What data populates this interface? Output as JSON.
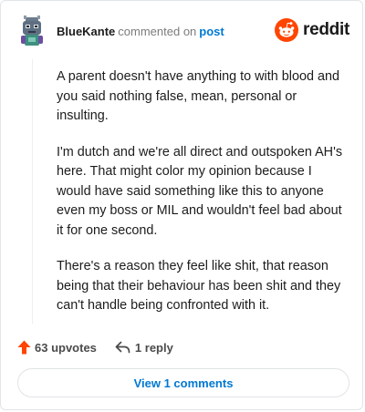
{
  "comment": {
    "author": "BlueKante",
    "action_text": "commented on",
    "post_link": "post",
    "paragraphs": [
      "A parent doesn't have anything to with blood and you said nothing false, mean, personal or insulting.",
      "I'm dutch and we're all direct and outspoken AH's here. That might color my opinion because I would have said something like this to anyone even my boss or MIL and wouldn't feel bad about it for one second.",
      "There's a reason they feel like shit, that reason being that their behaviour has been shit and they can't handle being confronted with it."
    ],
    "upvotes": "63 upvotes",
    "replies": "1 reply",
    "view_comments": "View 1 comments"
  },
  "brand": {
    "wordmark": "reddit",
    "logo_icon": "reddit-snoo-icon",
    "accent": "#ff4500"
  },
  "icons": {
    "avatar": "avatar-icon",
    "upvote": "upvote-arrow-icon",
    "reply": "reply-arrow-icon"
  },
  "colors": {
    "link": "#0079d3",
    "upvote": "#ff4500",
    "text": "#1c1c1c",
    "muted": "#7c7c7c"
  }
}
